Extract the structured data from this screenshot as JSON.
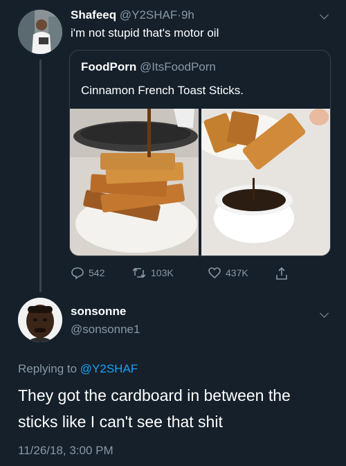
{
  "tweet": {
    "display_name": "Shafeeq",
    "handle": "@Y2SHAF",
    "separator": "·",
    "time": "9h",
    "text": "i'm not stupid that's motor oil",
    "avatar_icon": "person-avatar-icon"
  },
  "quoted": {
    "display_name": "FoodPorn",
    "handle": "@ItsFoodPorn",
    "text": "Cinnamon French Toast Sticks.",
    "images": [
      "french-toast-stack-photo",
      "french-toast-dip-syrup-photo"
    ]
  },
  "actions": {
    "replies": "542",
    "retweets": "103K",
    "likes": "437K"
  },
  "reply": {
    "display_name": "sonsonne",
    "handle": "@sonsonne1",
    "replying_prefix": "Replying to",
    "replying_to": "@Y2SHAF",
    "text_line1": "They got the cardboard in between the",
    "text_line2": "sticks like I can't see that shit",
    "timestamp": "11/26/18, 3:00 PM"
  },
  "colors": {
    "background": "#15202b",
    "muted": "#8899a6",
    "accent": "#1da1f2",
    "border": "#38444d"
  }
}
